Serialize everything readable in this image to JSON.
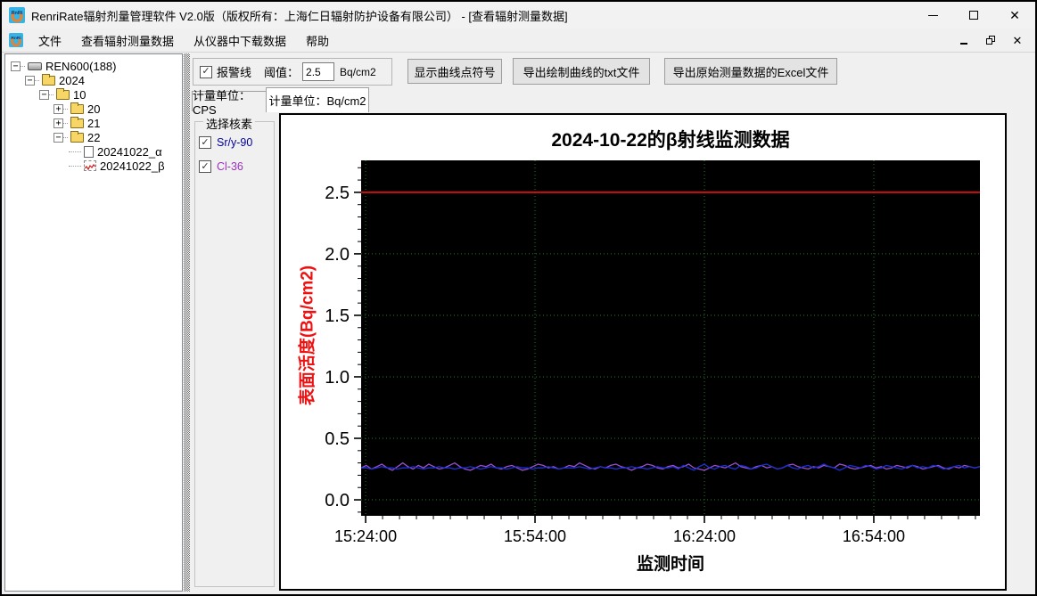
{
  "window": {
    "title": "RenriRate辐射剂量管理软件 V2.0版（版权所有：上海仁日辐射防护设备有限公司） - [查看辐射测量数据]"
  },
  "icons": {
    "close_icon": "✕",
    "check_icon": "✓",
    "expander_expanded": "−",
    "expander_collapsed": "+",
    "logo_text": "RnRi"
  },
  "menu": {
    "items": [
      {
        "label": "文件"
      },
      {
        "label": "查看辐射测量数据"
      },
      {
        "label": "从仪器中下载数据"
      },
      {
        "label": "帮助"
      }
    ]
  },
  "tree": {
    "items": [
      {
        "label": "REN600(188)",
        "level": 0,
        "expander": "expanded",
        "icon": "device"
      },
      {
        "label": "2024",
        "level": 1,
        "expander": "expanded",
        "icon": "folder"
      },
      {
        "label": "10",
        "level": 2,
        "expander": "expanded",
        "icon": "folder"
      },
      {
        "label": "20",
        "level": 3,
        "expander": "collapsed",
        "icon": "folder"
      },
      {
        "label": "21",
        "level": 3,
        "expander": "collapsed",
        "icon": "folder"
      },
      {
        "label": "22",
        "level": 3,
        "expander": "expanded",
        "icon": "folder"
      },
      {
        "label": "20241022_α",
        "level": 4,
        "expander": "none",
        "icon": "doc"
      },
      {
        "label": "20241022_β",
        "level": 4,
        "expander": "none",
        "icon": "chart"
      }
    ]
  },
  "toolbar": {
    "alarm_checkbox_label": "报警线",
    "alarm_checked": true,
    "threshold_label": "阈值：",
    "threshold_value": "2.5",
    "threshold_unit": "Bq/cm2",
    "show_points_button": "显示曲线点符号",
    "export_txt_button": "导出绘制曲线的txt文件",
    "export_excel_button": "导出原始测量数据的Excel文件"
  },
  "tabs": [
    {
      "label": "计量单位：CPS",
      "active": false
    },
    {
      "label": "计量单位：Bq/cm2",
      "active": true
    }
  ],
  "nuclide_panel": {
    "title": "选择核素",
    "items": [
      {
        "label": "Sr/y-90",
        "checked": true,
        "color": "#000099"
      },
      {
        "label": "Cl-36",
        "checked": true,
        "color": "#9933bb"
      }
    ]
  },
  "chart_data": {
    "type": "line",
    "title": "2024-10-22的β射线监测数据",
    "xlabel": "监测时间",
    "ylabel": "表面活度(Bq/cm2)",
    "ylabel_color": "#ee1111",
    "plot_bg": "#000000",
    "grid_color": "#1e7d1e",
    "grid_on": true,
    "legend_position": "none",
    "ylim": [
      -0.13,
      2.76
    ],
    "y_major_ticks": [
      0.0,
      0.5,
      1.0,
      1.5,
      2.0,
      2.5
    ],
    "y_minor_step": 0.1,
    "x_range_minutes": [
      923.2,
      1032.8
    ],
    "x_major_ticks": [
      {
        "minute": 924,
        "label": "15:24:00"
      },
      {
        "minute": 954,
        "label": "15:54:00"
      },
      {
        "minute": 984,
        "label": "16:24:00"
      },
      {
        "minute": 1014,
        "label": "16:54:00"
      }
    ],
    "x_minor_step_minutes": 3,
    "alarm_line": {
      "value": 2.5,
      "color": "#cc1111"
    },
    "series": [
      {
        "name": "Cl-36",
        "color": "#9a4fd0",
        "values": [
          0.26,
          0.28,
          0.25,
          0.27,
          0.29,
          0.26,
          0.24,
          0.27,
          0.3,
          0.27,
          0.25,
          0.28,
          0.26,
          0.29,
          0.27,
          0.25,
          0.26,
          0.28,
          0.3,
          0.27,
          0.25,
          0.24,
          0.26,
          0.28,
          0.27,
          0.29,
          0.26,
          0.25,
          0.27,
          0.28,
          0.26,
          0.24,
          0.25,
          0.27,
          0.29,
          0.28,
          0.26,
          0.27,
          0.25,
          0.26,
          0.28,
          0.27,
          0.3,
          0.28,
          0.26,
          0.25,
          0.27,
          0.26,
          0.28,
          0.29,
          0.27,
          0.26,
          0.24,
          0.26,
          0.27,
          0.29,
          0.28,
          0.26,
          0.25,
          0.27,
          0.28,
          0.26,
          0.27,
          0.29,
          0.26,
          0.25,
          0.24,
          0.26,
          0.28,
          0.27,
          0.26,
          0.28,
          0.3,
          0.27,
          0.26,
          0.25,
          0.27,
          0.28,
          0.26,
          0.27,
          0.25,
          0.26,
          0.28,
          0.29,
          0.27,
          0.26,
          0.25,
          0.27,
          0.26,
          0.28,
          0.27,
          0.26,
          0.29,
          0.28,
          0.26,
          0.25,
          0.26,
          0.27,
          0.28,
          0.26,
          0.27,
          0.25,
          0.26,
          0.28,
          0.27,
          0.26,
          0.28,
          0.27,
          0.25,
          0.26,
          0.27,
          0.28,
          0.26,
          0.25,
          0.27,
          0.26,
          0.28,
          0.27,
          0.26,
          0.27
        ]
      },
      {
        "name": "Sr/y-90",
        "color": "#1c2fd6",
        "values": [
          0.26,
          0.26,
          0.25,
          0.26,
          0.27,
          0.26,
          0.26,
          0.25,
          0.26,
          0.26,
          0.27,
          0.26,
          0.25,
          0.26,
          0.26,
          0.27,
          0.26,
          0.26,
          0.25,
          0.26,
          0.26,
          0.27,
          0.26,
          0.25,
          0.26,
          0.27,
          0.26,
          0.26,
          0.25,
          0.26,
          0.27,
          0.26,
          0.26,
          0.25,
          0.26,
          0.26,
          0.27,
          0.26,
          0.25,
          0.26,
          0.26,
          0.26,
          0.27,
          0.26,
          0.25,
          0.26,
          0.27,
          0.26,
          0.26,
          0.25,
          0.26,
          0.26,
          0.27,
          0.26,
          0.26,
          0.25,
          0.26,
          0.27,
          0.26,
          0.26,
          0.27,
          0.25,
          0.28,
          0.26,
          0.24,
          0.27,
          0.29,
          0.26,
          0.25,
          0.27,
          0.28,
          0.26,
          0.25,
          0.28,
          0.27,
          0.25,
          0.26,
          0.28,
          0.29,
          0.27,
          0.25,
          0.26,
          0.28,
          0.26,
          0.25,
          0.27,
          0.28,
          0.26,
          0.27,
          0.29,
          0.27,
          0.26,
          0.24,
          0.26,
          0.28,
          0.27,
          0.26,
          0.28,
          0.27,
          0.25,
          0.26,
          0.28,
          0.27,
          0.26,
          0.25,
          0.27,
          0.28,
          0.26,
          0.27,
          0.26,
          0.28,
          0.27,
          0.25,
          0.26,
          0.27,
          0.28,
          0.26,
          0.27,
          0.26,
          0.27
        ]
      }
    ]
  }
}
